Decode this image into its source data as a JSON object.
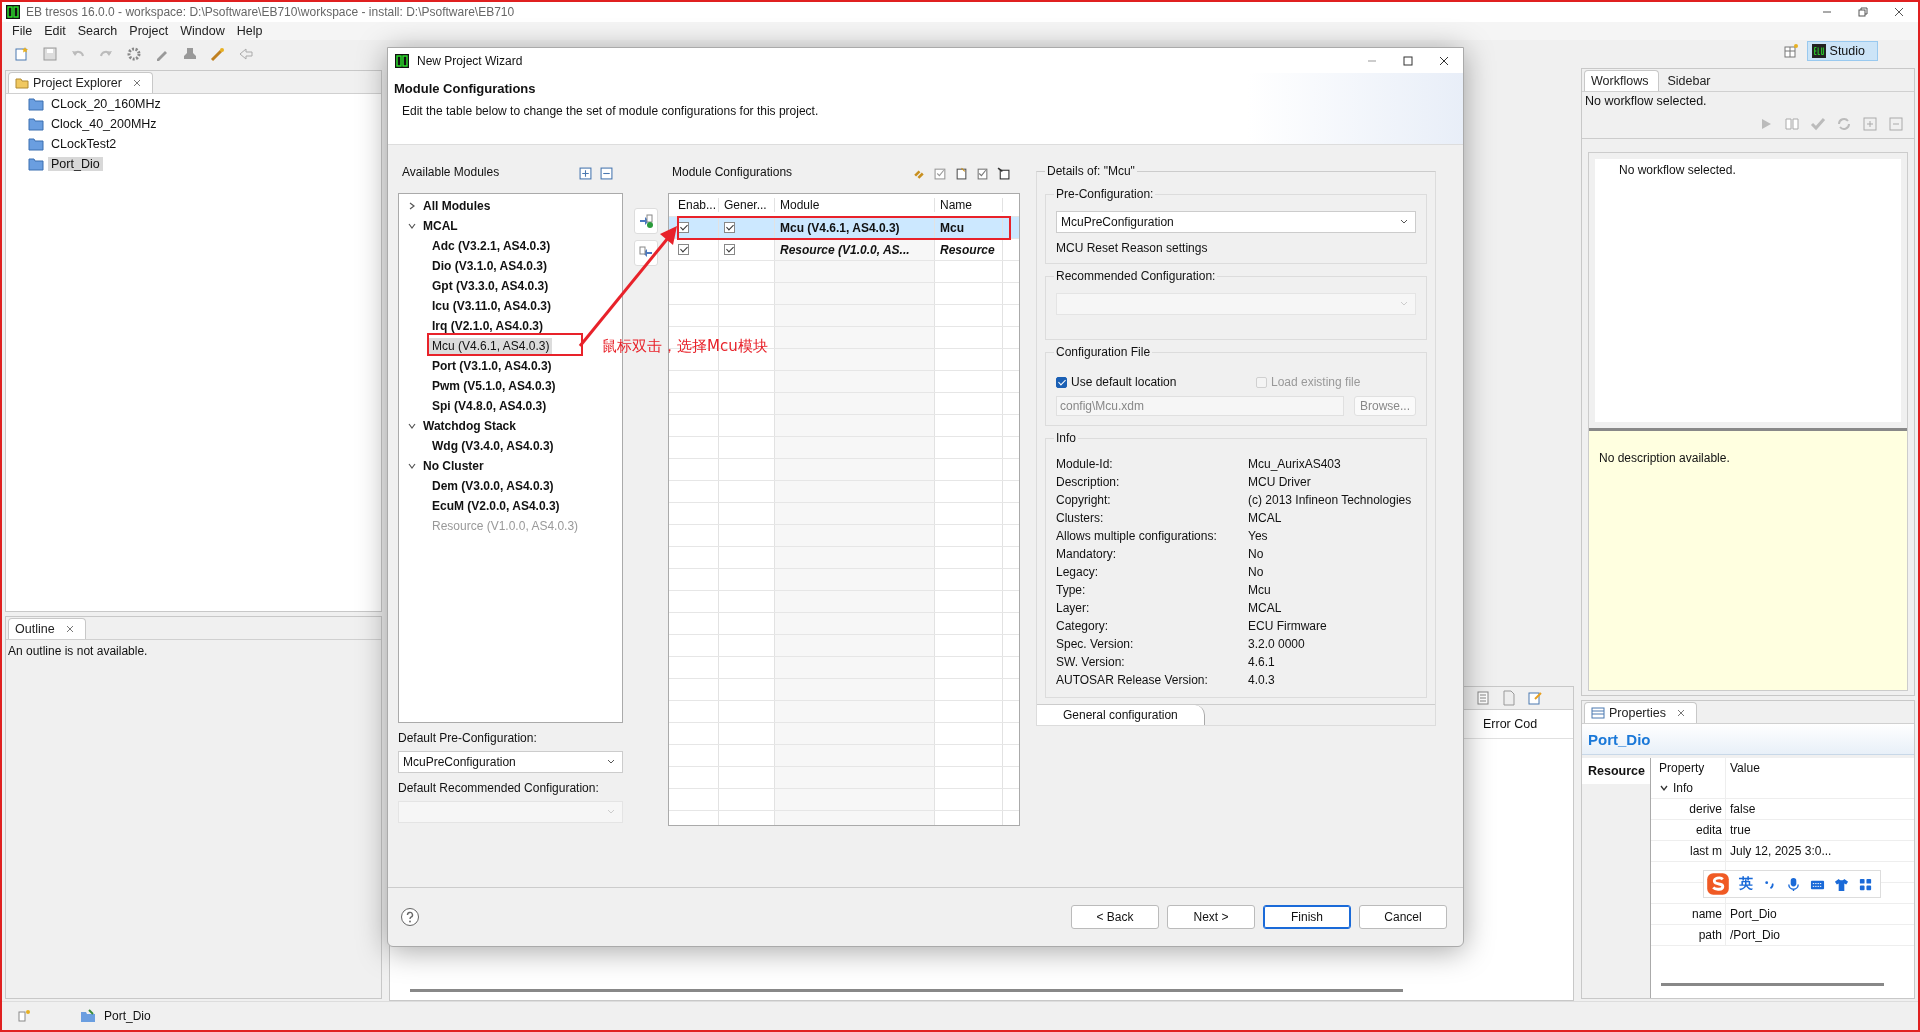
{
  "app_title": "EB tresos 16.0.0 - workspace: D:\\Psoftware\\EB710\\workspace - install: D:\\Psoftware\\EB710",
  "menu": [
    "File",
    "Edit",
    "Search",
    "Project",
    "Window",
    "Help"
  ],
  "perspective": {
    "label": "Studio",
    "selected": true
  },
  "project_explorer": {
    "title": "Project Explorer",
    "items": [
      {
        "label": "CLock_20_160MHz",
        "selected": false
      },
      {
        "label": "Clock_40_200MHz",
        "selected": false
      },
      {
        "label": "CLockTest2",
        "selected": false
      },
      {
        "label": "Port_Dio",
        "selected": true
      }
    ]
  },
  "outline": {
    "title": "Outline",
    "message": "An outline is not available."
  },
  "problems": {
    "columns": [
      "Error Cod"
    ]
  },
  "workflows": {
    "tabs": [
      {
        "label": "Workflows",
        "selected": true
      },
      {
        "label": "Sidebar",
        "selected": false
      }
    ],
    "status": "No workflow selected.",
    "list_message": "No workflow selected.",
    "description": "No description available."
  },
  "properties": {
    "title": "Properties",
    "resource": "Port_Dio",
    "side_tabs": [
      {
        "label": "Resource",
        "selected": true
      }
    ],
    "columns": [
      "Property",
      "Value"
    ],
    "group": {
      "label": "Info",
      "expanded": true
    },
    "rows": [
      {
        "kind": "row",
        "property": "derive",
        "value": "false"
      },
      {
        "kind": "row",
        "property": "edita",
        "value": "true"
      },
      {
        "kind": "row",
        "property": "last m",
        "value": "July 12, 2025 3:0..."
      },
      {
        "kind": "covered"
      },
      {
        "kind": "covered"
      },
      {
        "kind": "row",
        "property": "name",
        "value": "Port_Dio"
      },
      {
        "kind": "row",
        "property": "path",
        "value": "/Port_Dio"
      }
    ]
  },
  "status_bar": {
    "item": "Port_Dio"
  },
  "dialog": {
    "title": "New Project Wizard",
    "heading": "Module Configurations",
    "description": "Edit the table below to change the set of module configurations for this project.",
    "available": {
      "title": "Available Modules",
      "tree": [
        {
          "label": "All Modules",
          "expanded": false
        },
        {
          "label": "MCAL",
          "expanded": true,
          "children": [
            {
              "label": "Adc (V3.2.1, AS4.0.3)",
              "selected": false,
              "disabled": false
            },
            {
              "label": "Dio (V3.1.0, AS4.0.3)",
              "selected": false,
              "disabled": false
            },
            {
              "label": "Gpt (V3.3.0, AS4.0.3)",
              "selected": false,
              "disabled": false
            },
            {
              "label": "Icu (V3.11.0, AS4.0.3)",
              "selected": false,
              "disabled": false
            },
            {
              "label": "Irq (V2.1.0, AS4.0.3)",
              "selected": false,
              "disabled": false
            },
            {
              "label": "Mcu (V4.6.1, AS4.0.3)",
              "selected": true,
              "disabled": false
            },
            {
              "label": "Port (V3.1.0, AS4.0.3)",
              "selected": false,
              "disabled": false
            },
            {
              "label": "Pwm (V5.1.0, AS4.0.3)",
              "selected": false,
              "disabled": false
            },
            {
              "label": "Spi (V4.8.0, AS4.0.3)",
              "selected": false,
              "disabled": false
            }
          ]
        },
        {
          "label": "Watchdog Stack",
          "expanded": true,
          "children": [
            {
              "label": "Wdg (V3.4.0, AS4.0.3)",
              "selected": false,
              "disabled": false
            }
          ]
        },
        {
          "label": "No Cluster",
          "expanded": true,
          "children": [
            {
              "label": "Dem (V3.0.0, AS4.0.3)",
              "selected": false,
              "disabled": false
            },
            {
              "label": "EcuM (V2.0.0, AS4.0.3)",
              "selected": false,
              "disabled": false
            },
            {
              "label": "Resource (V1.0.0, AS4.0.3)",
              "selected": false,
              "disabled": true
            }
          ]
        }
      ]
    },
    "default_pre_configuration": {
      "label": "Default Pre-Configuration:",
      "value": "McuPreConfiguration"
    },
    "default_recommended": {
      "label": "Default Recommended Configuration:",
      "disabled": true
    },
    "configurations": {
      "title": "Module Configurations",
      "columns": [
        "Enab...",
        "Gener...",
        "Module",
        "Name"
      ],
      "rows": [
        {
          "kind": "module",
          "enabled": true,
          "generate": true,
          "module": "Mcu (V4.6.1, AS4.0.3)",
          "name": "Mcu",
          "selected": true
        },
        {
          "kind": "resource",
          "enabled": true,
          "generate": true,
          "module": "Resource (V1.0.0, AS...",
          "name": "Resource",
          "selected": false
        }
      ]
    },
    "details": {
      "title": "Details of: \"Mcu\"",
      "pre_configuration": {
        "label": "Pre-Configuration:",
        "value": "McuPreConfiguration",
        "note": "MCU Reset Reason settings"
      },
      "recommended": {
        "label": "Recommended Configuration:",
        "disabled": true
      },
      "config_file": {
        "label": "Configuration File",
        "use_default": {
          "label": "Use default location",
          "checked": true
        },
        "load_existing": {
          "label": "Load existing file",
          "checked": false,
          "disabled": true
        },
        "path": "config\\Mcu.xdm",
        "browse": "Browse..."
      },
      "info": {
        "label": "Info",
        "rows": [
          {
            "key": "Module-Id:",
            "value": "Mcu_AurixAS403"
          },
          {
            "key": "Description:",
            "value": "MCU Driver"
          },
          {
            "key": "Copyright:",
            "value": "(c) 2013 Infineon Technologies"
          },
          {
            "key": "Clusters:",
            "value": "MCAL"
          },
          {
            "key": "Allows multiple configurations:",
            "value": "Yes"
          },
          {
            "key": "Mandatory:",
            "value": "No"
          },
          {
            "key": "Legacy:",
            "value": "No"
          },
          {
            "key": "Type:",
            "value": "Mcu"
          },
          {
            "key": "Layer:",
            "value": "MCAL"
          },
          {
            "key": "Category:",
            "value": "ECU Firmware"
          },
          {
            "key": "Spec. Version:",
            "value": "3.2.0 0000"
          },
          {
            "key": "SW. Version:",
            "value": "4.6.1"
          },
          {
            "key": "AUTOSAR Release Version:",
            "value": "4.0.3"
          }
        ]
      },
      "tabs": [
        {
          "label": "General configuration",
          "selected": true
        }
      ]
    },
    "buttons": [
      {
        "label": "< Back",
        "kind": "normal"
      },
      {
        "label": "Next >",
        "kind": "normal"
      },
      {
        "label": "Finish",
        "kind": "default"
      },
      {
        "label": "Cancel",
        "kind": "normal"
      }
    ]
  },
  "annotation": {
    "text": "鼠标双击，选择Mcu模块"
  },
  "ime_toolbar": {
    "language": "英"
  }
}
